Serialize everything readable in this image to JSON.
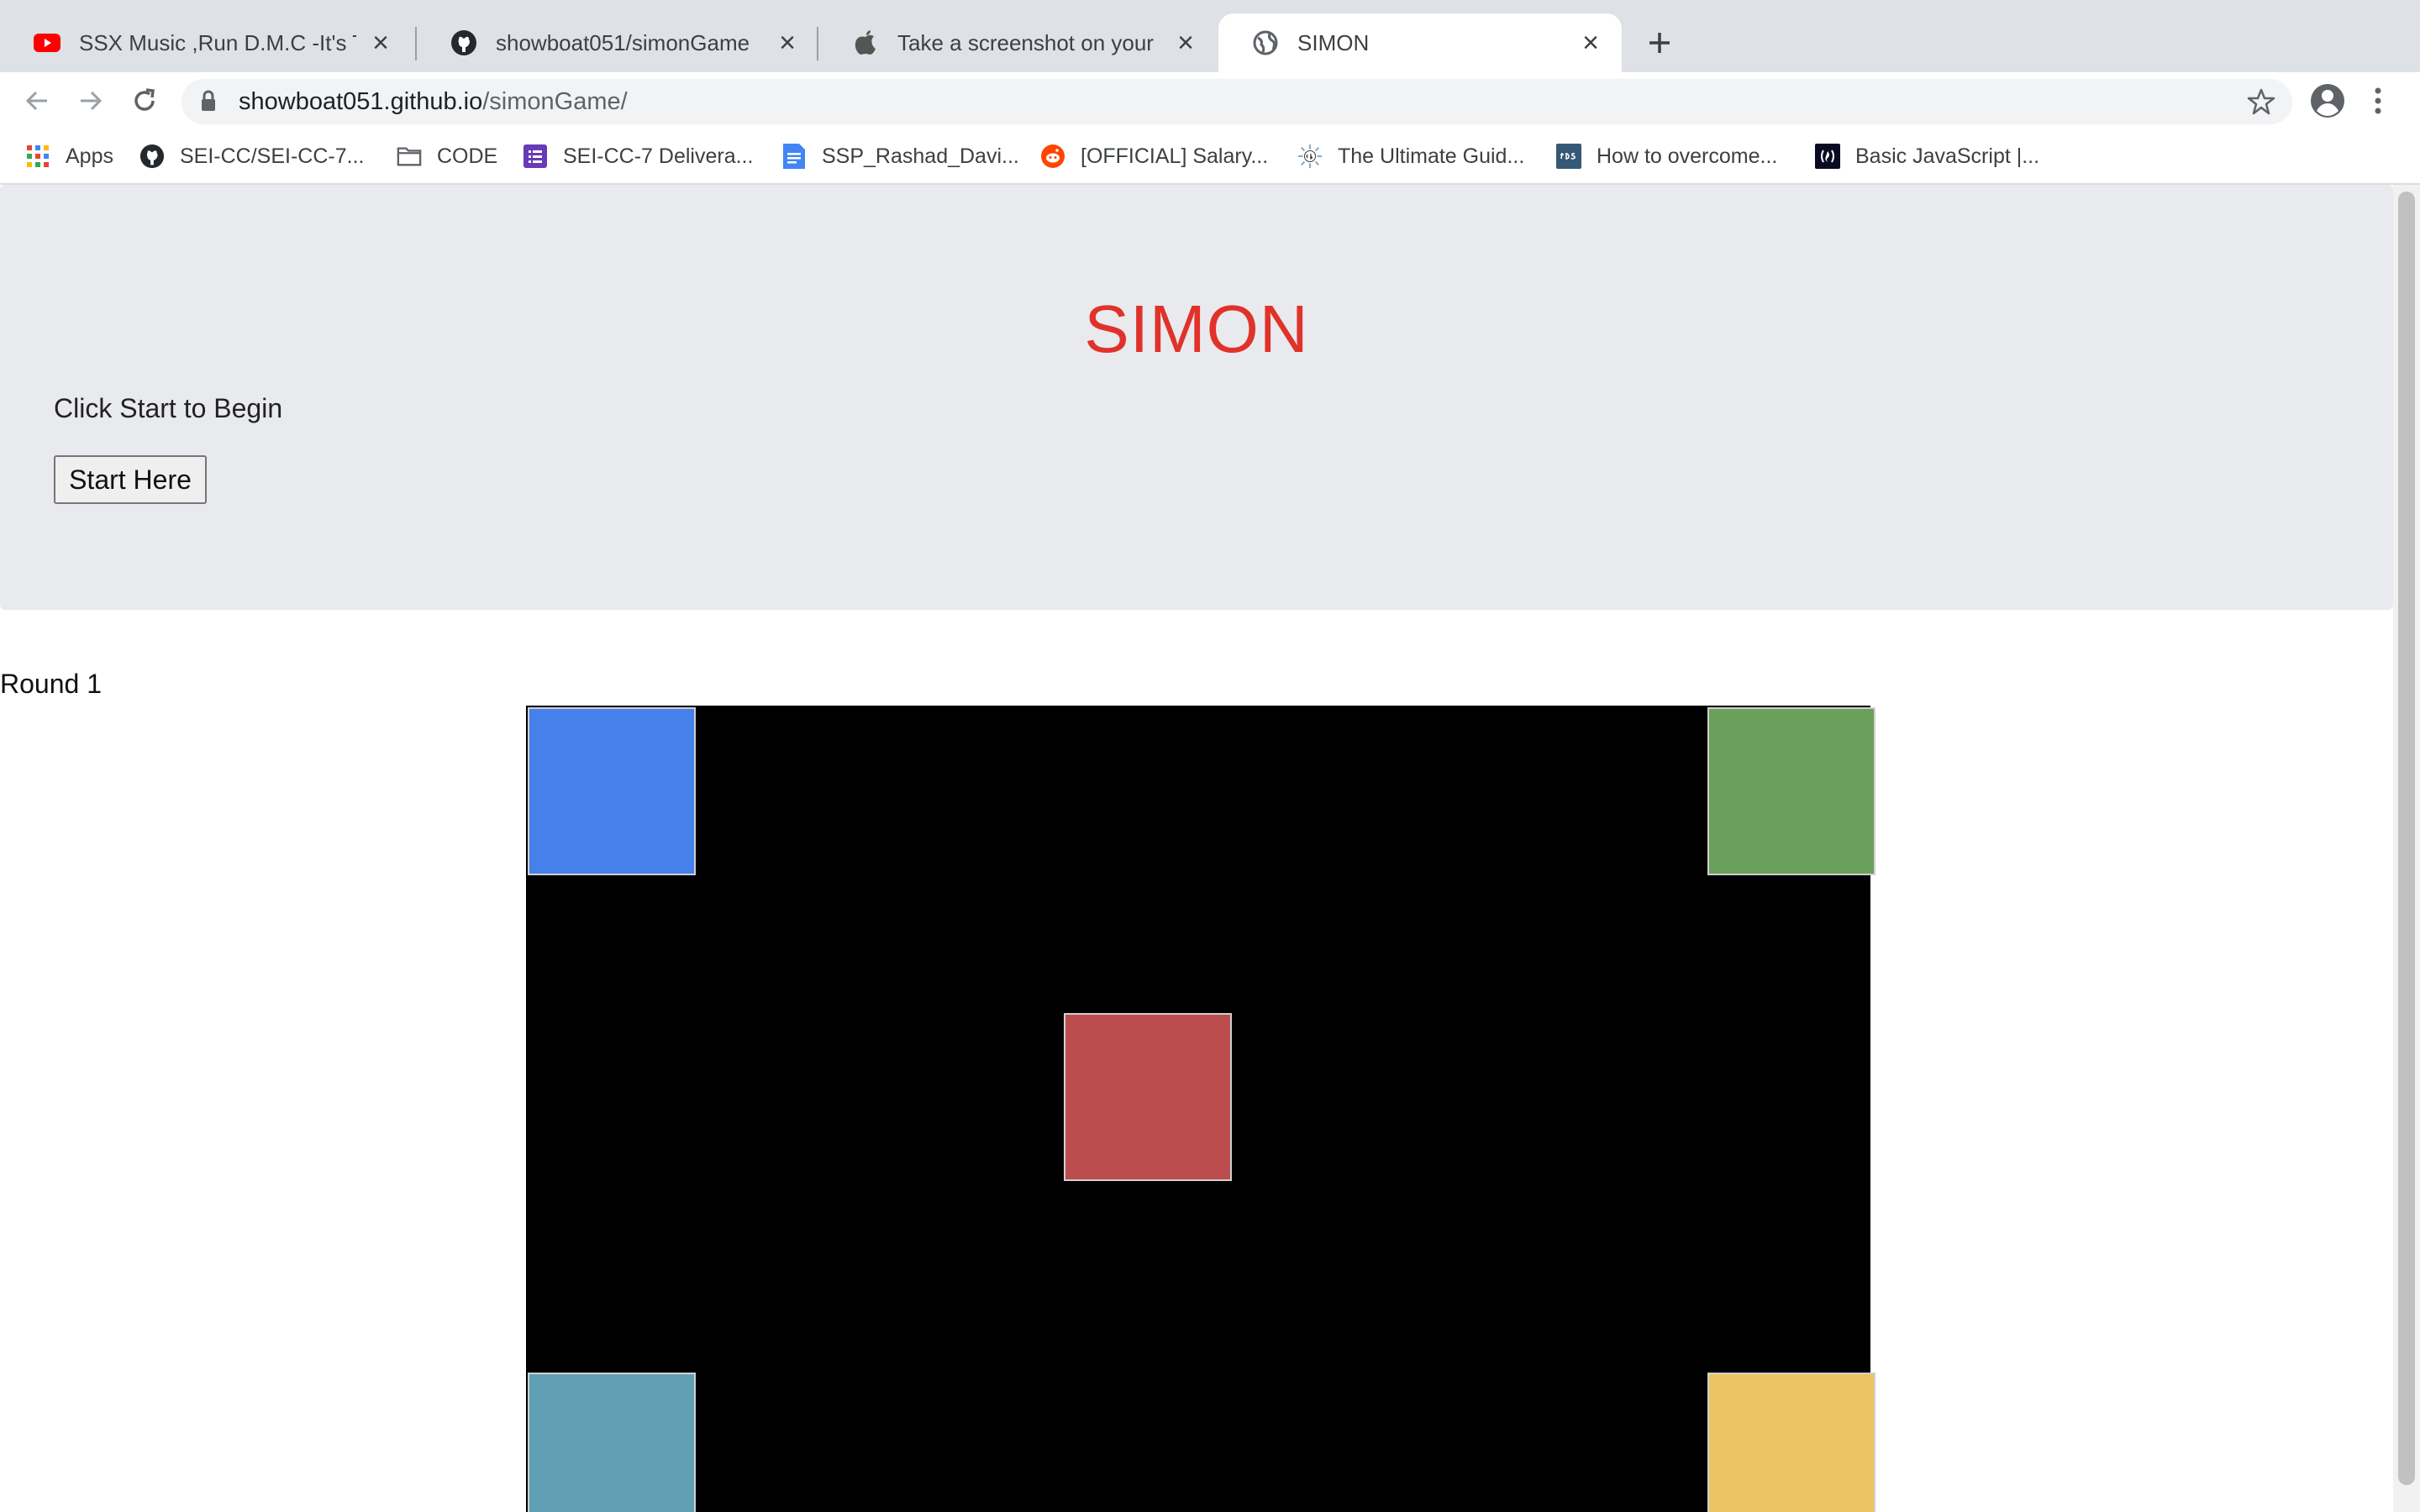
{
  "tabs": [
    {
      "title": "SSX Music ,Run D.M.C -It's Tricky",
      "icon": "youtube-icon",
      "active": false
    },
    {
      "title": "showboat051/simonGame",
      "icon": "github-icon",
      "active": false
    },
    {
      "title": "Take a screenshot on your Mac",
      "icon": "apple-icon",
      "active": false
    },
    {
      "title": "SIMON",
      "icon": "globe-icon",
      "active": true
    }
  ],
  "address_bar": {
    "host": "showboat051.github.io",
    "path": "/simonGame/"
  },
  "bookmarks": [
    {
      "label": "Apps",
      "icon": "apps-grid-icon"
    },
    {
      "label": "SEI-CC/SEI-CC-7...",
      "icon": "github-icon"
    },
    {
      "label": "CODE",
      "icon": "folder-icon"
    },
    {
      "label": "SEI-CC-7 Delivera...",
      "icon": "forms-icon"
    },
    {
      "label": "SSP_Rashad_Davi...",
      "icon": "docs-icon"
    },
    {
      "label": "[OFFICIAL] Salary...",
      "icon": "reddit-icon"
    },
    {
      "label": "The Ultimate Guid...",
      "icon": "cb-icon"
    },
    {
      "label": "How to overcome...",
      "icon": "tds-icon"
    },
    {
      "label": "Basic JavaScript |...",
      "icon": "freecodecamp-icon"
    }
  ],
  "page": {
    "title": "SIMON",
    "instruction": "Click Start to Begin",
    "start_button": "Start Here",
    "round_label": "Round 1"
  },
  "colors": {
    "title": "#e0322a",
    "pad_blue": "#4580eb",
    "pad_green": "#6aa05b",
    "pad_red": "#bb4d4e",
    "pad_teal": "#619fb5",
    "pad_yellow": "#edc462"
  }
}
